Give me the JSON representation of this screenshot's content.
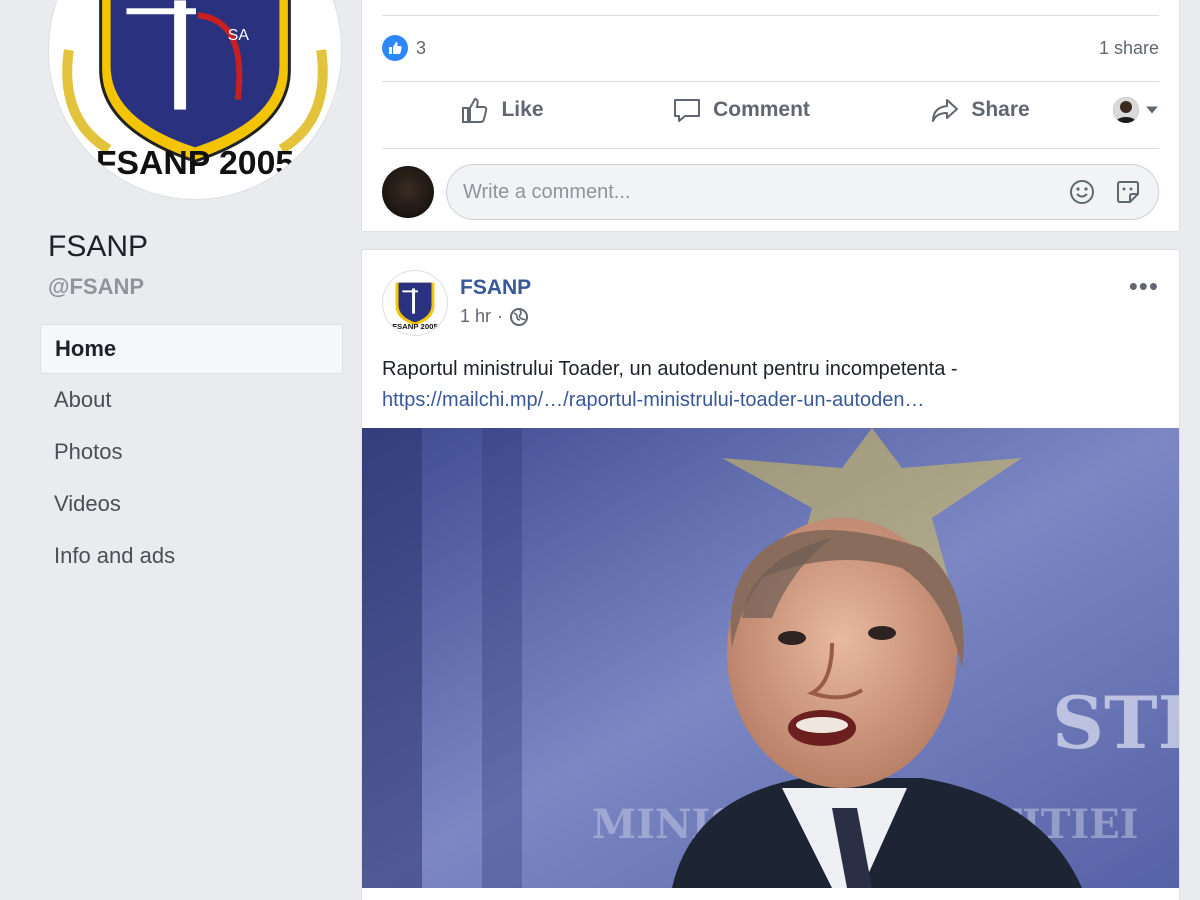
{
  "page": {
    "name": "FSANP",
    "handle": "@FSANP",
    "logo_text": "FSANP 2005"
  },
  "nav": {
    "items": [
      {
        "label": "Home",
        "active": true
      },
      {
        "label": "About"
      },
      {
        "label": "Photos"
      },
      {
        "label": "Videos"
      },
      {
        "label": "Info and ads"
      }
    ]
  },
  "prev_post": {
    "reaction_count": "3",
    "share_count": "1 share",
    "actions": {
      "like": "Like",
      "comment": "Comment",
      "share": "Share"
    },
    "comment_placeholder": "Write a comment..."
  },
  "post": {
    "author": "FSANP",
    "time": "1 hr",
    "separator": "·",
    "text": "Raportul ministrului Toader, un autodenunt pentru incompetenta -",
    "link": "https://mailchi.mp/…/raportul-ministrului-toader-un-autoden…",
    "more_label": "•••",
    "image_overlay_text": "STR",
    "image_overlay_text2": "MINISTERUL JUSTITIEI"
  },
  "icons": {
    "like_badge": "thumbs-up-icon",
    "like": "thumbs-up-outline-icon",
    "comment": "speech-bubble-icon",
    "share": "share-arrow-icon",
    "globe": "globe-icon",
    "emoji": "smiley-icon",
    "sticker": "sticker-icon"
  },
  "colors": {
    "link": "#385898",
    "like_blue": "#2d88ff",
    "background": "#e9ebee"
  }
}
